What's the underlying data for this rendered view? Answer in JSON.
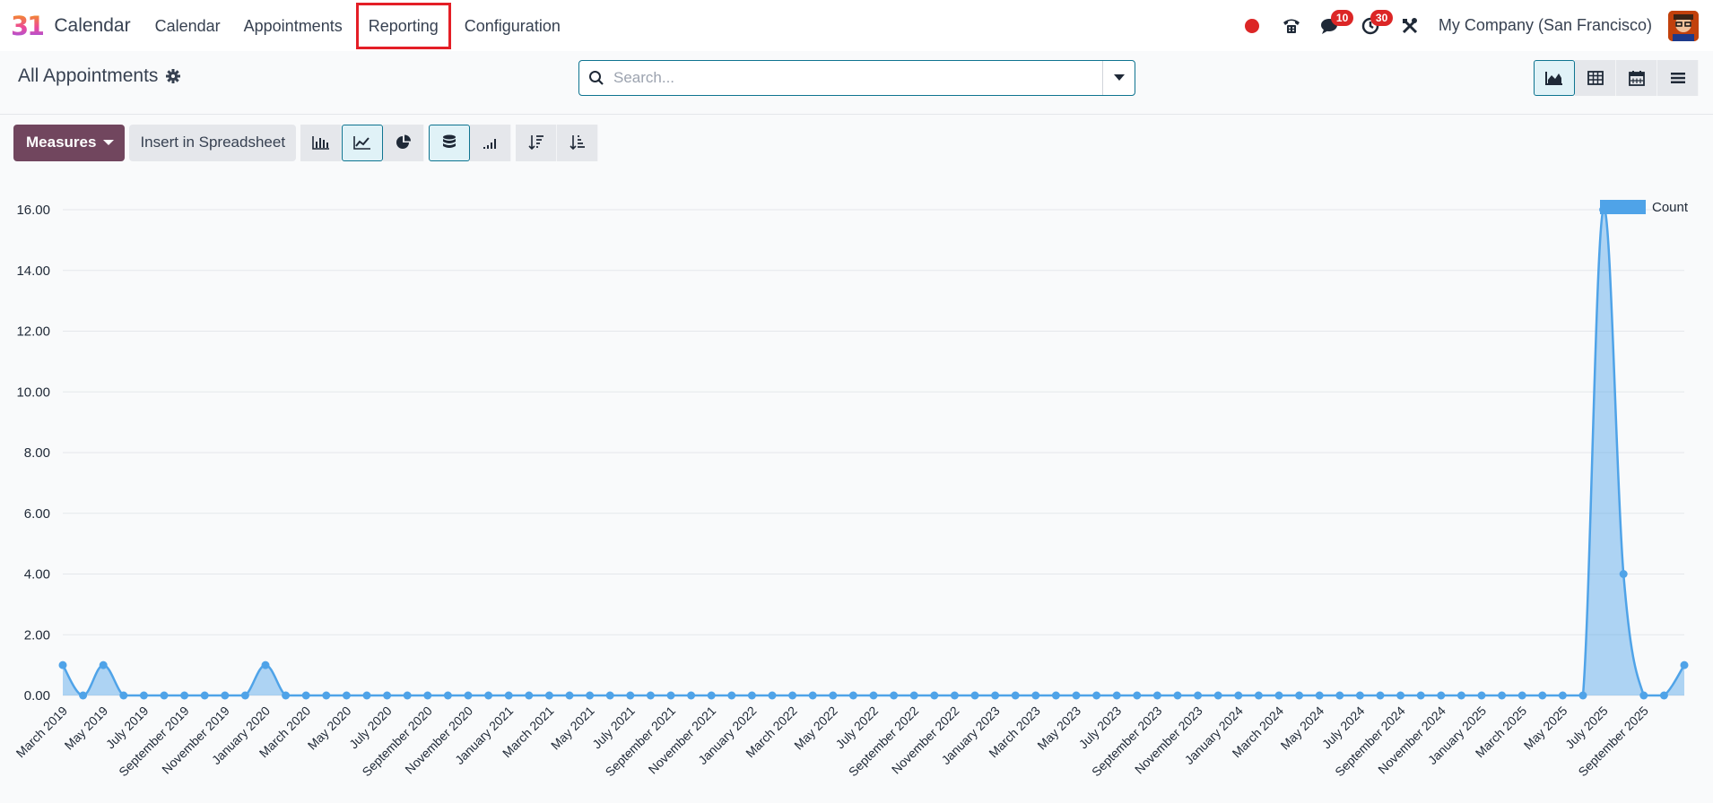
{
  "app": {
    "name": "Calendar",
    "logo_text": "31"
  },
  "menu": {
    "items": [
      "Calendar",
      "Appointments",
      "Reporting",
      "Configuration"
    ],
    "highlighted": "Reporting"
  },
  "systray": {
    "messages_badge": "10",
    "activities_badge": "30",
    "company": "My Company (San Francisco)"
  },
  "control_panel": {
    "title": "All Appointments",
    "search_placeholder": "Search..."
  },
  "toolbar": {
    "measures_label": "Measures",
    "spreadsheet_label": "Insert in Spreadsheet"
  },
  "colors": {
    "accent": "#0e7490",
    "primary": "#71465e",
    "series": "#4fa3e8",
    "highlight": "#e41e26"
  },
  "chart_data": {
    "type": "line",
    "area": true,
    "title": "",
    "xlabel": "",
    "ylabel": "",
    "ylim": [
      0,
      16
    ],
    "yticks": [
      "0.00",
      "2.00",
      "4.00",
      "6.00",
      "8.00",
      "10.00",
      "12.00",
      "14.00",
      "16.00"
    ],
    "grid": true,
    "legend_position": "top-right",
    "series": [
      {
        "name": "Count",
        "values": [
          1,
          0,
          1,
          0,
          0,
          0,
          0,
          0,
          0,
          0,
          1,
          0,
          0,
          0,
          0,
          0,
          0,
          0,
          0,
          0,
          0,
          0,
          0,
          0,
          0,
          0,
          0,
          0,
          0,
          0,
          0,
          0,
          0,
          0,
          0,
          0,
          0,
          0,
          0,
          0,
          0,
          0,
          0,
          0,
          0,
          0,
          0,
          0,
          0,
          0,
          0,
          0,
          0,
          0,
          0,
          0,
          0,
          0,
          0,
          0,
          0,
          0,
          0,
          0,
          0,
          0,
          0,
          0,
          0,
          0,
          0,
          0,
          0,
          0,
          0,
          0,
          16,
          4,
          0,
          0,
          1
        ]
      }
    ],
    "x_labels": [
      "March 2019",
      "May 2019",
      "July 2019",
      "September 2019",
      "November 2019",
      "January 2020",
      "March 2020",
      "May 2020",
      "July 2020",
      "September 2020",
      "November 2020",
      "January 2021",
      "March 2021",
      "May 2021",
      "July 2021",
      "September 2021",
      "November 2021",
      "January 2022",
      "March 2022",
      "May 2022",
      "July 2022",
      "September 2022",
      "November 2022",
      "January 2023",
      "March 2023",
      "May 2023",
      "July 2023",
      "September 2023",
      "November 2023",
      "January 2024",
      "March 2024",
      "May 2024",
      "July 2024",
      "September 2024",
      "November 2024",
      "January 2025",
      "March 2025",
      "May 2025",
      "July 2025",
      "September 2025"
    ]
  }
}
